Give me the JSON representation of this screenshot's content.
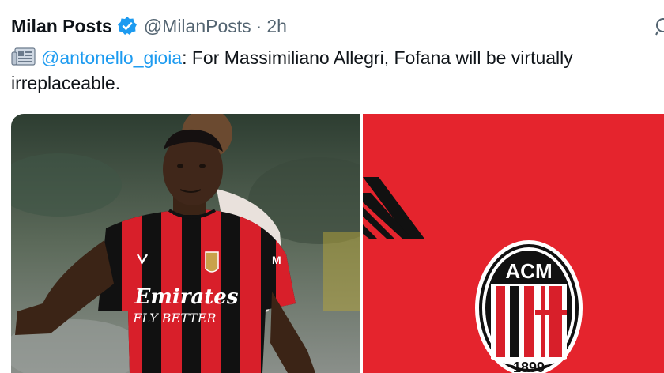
{
  "tweet": {
    "display_name": "Milan Posts",
    "handle": "@MilanPosts",
    "separator": "·",
    "time": "2h",
    "mention": "@antonello_gioia",
    "body": ": For Massimiliano Allegri, Fofana will be virtually irreplaceable."
  },
  "media": {
    "shirt_sponsor_line1": "Emirates",
    "shirt_sponsor_line2": "FLY BETTER",
    "logo_text_top": "ACM",
    "logo_text_year": "1899"
  },
  "colors": {
    "verified": "#1d9bf0",
    "mention": "#1d9bf0",
    "handle": "#536471",
    "milan_red": "#e5242d",
    "milan_black": "#111111"
  },
  "icons": [
    "verified-badge-icon",
    "newspaper-icon",
    "more-icon"
  ]
}
